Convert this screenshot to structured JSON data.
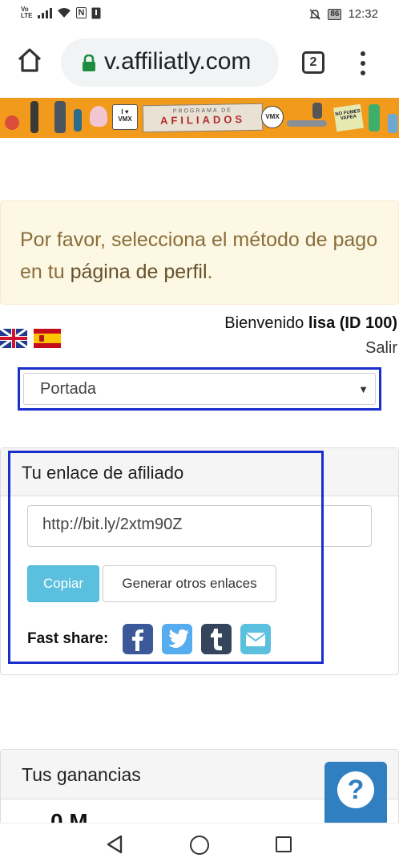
{
  "status_bar": {
    "volte_top": "Vo",
    "volte_bottom": "LTE",
    "nfc": "N",
    "battery": "86",
    "time": "12:32"
  },
  "browser": {
    "url": "v.affiliatly.com",
    "tab_count": "2",
    "icons": [
      "home-icon",
      "lock-icon",
      "tabs-icon",
      "menu-icon"
    ]
  },
  "banner": {
    "heart_logo_top": "I ♥",
    "heart_logo_bottom": "VMX",
    "subtitle": "PROGRAMA DE",
    "title": "AFILIADOS",
    "vmx_circle": "VMX",
    "vapea_note": "NO FUMES VAPEA"
  },
  "alert": {
    "text_before": "Por favor, selecciona el método de pago en tu ",
    "link": "página de perfil",
    "text_after": "."
  },
  "welcome": {
    "greeting": "Bienvenido ",
    "user": "lisa (ID 100)",
    "logout": "Salir"
  },
  "nav_select": {
    "selected": "Portada"
  },
  "affiliate_panel": {
    "title": "Tu enlace de afiliado",
    "link": "http://bit.ly/2xtm90Z",
    "copy_button": "Copiar",
    "generate_button": "Generar otros enlaces",
    "fast_share_label": "Fast share:",
    "share_icons": [
      "facebook-icon",
      "twitter-icon",
      "tumblr-icon",
      "email-icon"
    ]
  },
  "earnings_panel": {
    "title": "Tus ganancias",
    "value_partial": "0 M..."
  },
  "help_button": {
    "icon": "question-icon",
    "symbol": "?"
  },
  "accent_colors": {
    "highlight_border": "#1a2ecc",
    "banner_bg": "#f29a1c",
    "alert_bg": "#fcf8e3",
    "alert_text": "#8a6d3b",
    "copy_btn": "#5bc0de",
    "help_btn": "#2f7fc1"
  }
}
